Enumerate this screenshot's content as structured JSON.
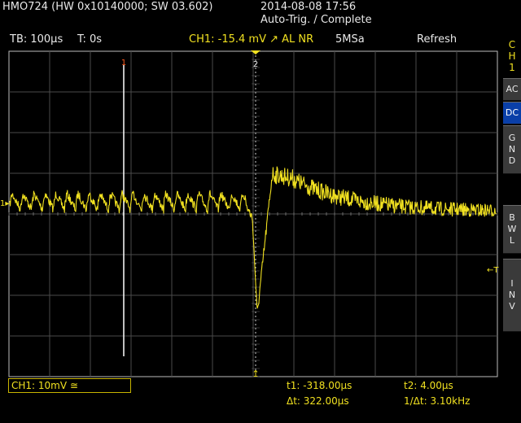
{
  "header": {
    "device": "HMO724 (HW 0x10140000; SW 03.602)",
    "datetime": "2014-08-08 17:56",
    "trigger_status": "Auto-Trig. / Complete"
  },
  "statusbar": {
    "timebase": "TB: 100µs",
    "trigger_time": "T: 0s",
    "trigger": "CH1: -15.4 mV ↗ AL NR",
    "sample_rate": "5MSa",
    "acq_mode": "Refresh"
  },
  "sidebar": {
    "channel": [
      "C",
      "H",
      "1"
    ],
    "buttons": [
      {
        "label": [
          "AC"
        ],
        "active": false
      },
      {
        "label": [
          "DC"
        ],
        "active": true
      },
      {
        "label": [
          "G",
          "N",
          "D"
        ],
        "active": false
      },
      {
        "label": [
          "B",
          "W",
          "L"
        ],
        "active": false
      },
      {
        "label": [
          "I",
          "N",
          "V"
        ],
        "active": false
      }
    ]
  },
  "markers": {
    "cursor1": "1",
    "cursor2": "2",
    "ch1_ref": "1",
    "trigger_level": "←T"
  },
  "footer": {
    "ch1_scale": "CH1: 10mV ≅",
    "t1": "t1: -318.00µs",
    "t2": "t2: 4.00µs",
    "dt": "Δt: 322.00µs",
    "inv_dt": "1/Δt: 3.10kHz"
  },
  "colors": {
    "trace": "#f0e020",
    "grid": "#4a4a4a",
    "cursor": "#ffffff",
    "marker": "#ff5a1e",
    "active_button": "#0a3fa8"
  }
}
